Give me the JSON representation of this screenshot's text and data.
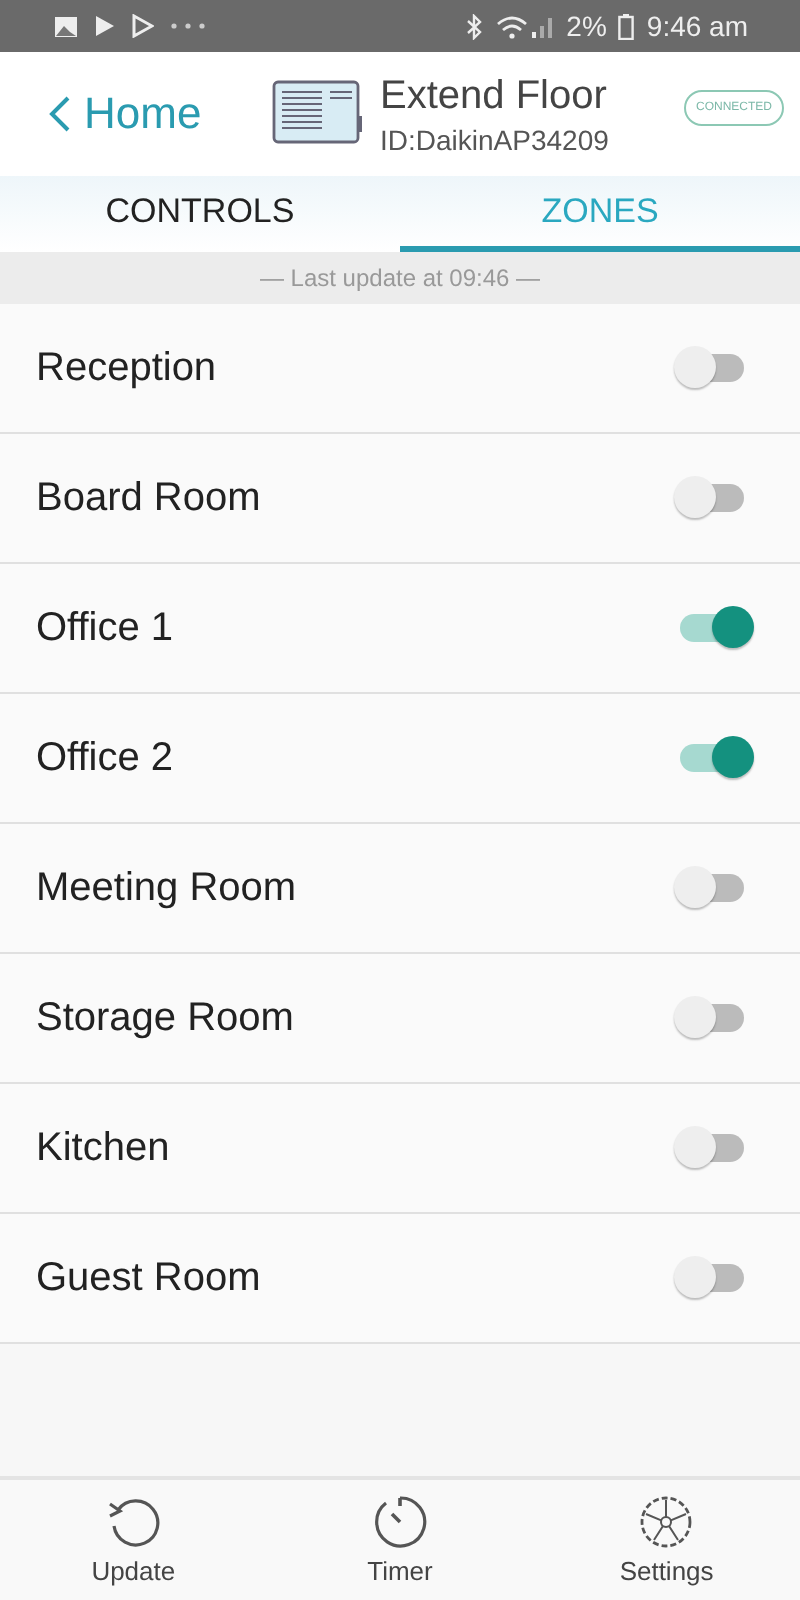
{
  "status_bar": {
    "battery": "2%",
    "time": "9:46 am"
  },
  "header": {
    "back": "Home",
    "title": "Extend Floor",
    "device_id": "ID:DaikinAP34209",
    "badge": "CONNECTED"
  },
  "tabs": [
    {
      "label": "CONTROLS",
      "selected": false
    },
    {
      "label": "ZONES",
      "selected": true
    }
  ],
  "last_update": "— Last update at 09:46 —",
  "zones": [
    {
      "name": "Reception",
      "on": false
    },
    {
      "name": "Board Room",
      "on": false
    },
    {
      "name": "Office 1",
      "on": true
    },
    {
      "name": "Office 2",
      "on": true
    },
    {
      "name": "Meeting Room",
      "on": false
    },
    {
      "name": "Storage Room",
      "on": false
    },
    {
      "name": "Kitchen",
      "on": false
    },
    {
      "name": "Guest Room",
      "on": false
    }
  ],
  "bottom_nav": [
    {
      "label": "Update",
      "kind": "update"
    },
    {
      "label": "Timer",
      "kind": "timer"
    },
    {
      "label": "Settings",
      "kind": "settings"
    }
  ]
}
